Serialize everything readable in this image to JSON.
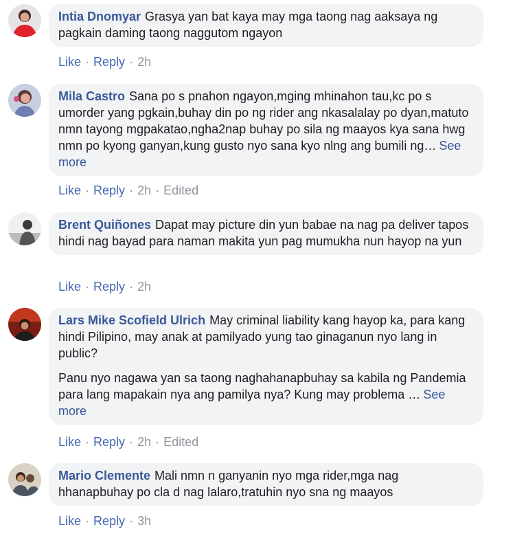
{
  "action_labels": {
    "like": "Like",
    "reply": "Reply",
    "separator": "·"
  },
  "comments": [
    {
      "author": "Intia Dnomyar",
      "paragraphs": [
        "Grasya yan bat kaya may mga taong nag aaksaya ng pagkain daming taong naggutom ngayon"
      ],
      "see_more": "",
      "time": "2h",
      "edited": ""
    },
    {
      "author": "Mila Castro",
      "paragraphs": [
        "Sana po s pnahon ngayon,mging mhinahon tau,kc po s umorder yang pgkain,buhay din po ng rider ang nkasalalay po dyan,matuto nmn tayong mgpakatao,ngha2nap buhay po sila ng maayos kya sana hwg nmn po kyong ganyan,kung gusto nyo sana kyo nlng ang bumili ng…"
      ],
      "see_more": "See more",
      "time": "2h",
      "edited": "Edited"
    },
    {
      "author": "Brent Quiñones",
      "paragraphs": [
        "Dapat may picture din yun babae na nag pa deliver tapos hindi nag bayad para naman makita yun pag mumukha nun hayop na yun"
      ],
      "see_more": "",
      "time": "2h",
      "edited": ""
    },
    {
      "author": "Lars Mike Scofield Ulrich",
      "paragraphs": [
        "May criminal liability kang hayop ka, para kang hindi Pilipino, may anak at pamilyado yung tao ginaganun nyo lang in public?",
        "Panu nyo nagawa yan sa taong naghahanapbuhay sa kabila ng Pandemia para lang mapakain nya ang pamilya nya? Kung may problema …"
      ],
      "see_more": "See more",
      "time": "2h",
      "edited": "Edited"
    },
    {
      "author": "Mario Clemente",
      "paragraphs": [
        "Mali nmn n ganyanin nyo mga rider,mga nag hhanapbuhay po cla d nag lalaro,tratuhin nyo sna ng maayos"
      ],
      "see_more": "",
      "time": "3h",
      "edited": ""
    }
  ]
}
